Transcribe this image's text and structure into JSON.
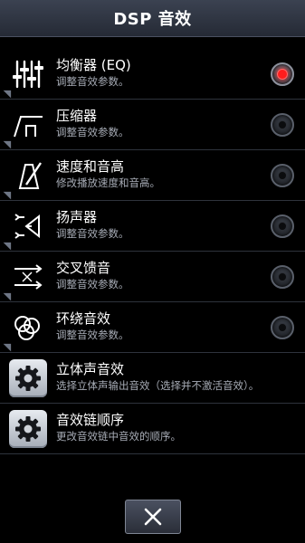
{
  "header": {
    "title": "DSP 音效"
  },
  "items": [
    {
      "name": "均衡器 (EQ)",
      "desc": "调整音效参数。",
      "icon": "equalizer-icon",
      "selected": true
    },
    {
      "name": "压缩器",
      "desc": "调整音效参数。",
      "icon": "compressor-icon",
      "selected": false
    },
    {
      "name": "速度和音高",
      "desc": "修改播放速度和音高。",
      "icon": "metronome-icon",
      "selected": false
    },
    {
      "name": "扬声器",
      "desc": "调整音效参数。",
      "icon": "speaker-icon",
      "selected": false
    },
    {
      "name": "交叉馈音",
      "desc": "调整音效参数。",
      "icon": "crossfeed-icon",
      "selected": false
    },
    {
      "name": "环绕音效",
      "desc": "调整音效参数。",
      "icon": "surround-icon",
      "selected": false
    },
    {
      "name": "立体声音效",
      "desc": "选择立体声输出音效（选择并不激活音效）。",
      "icon": "gear-icon"
    },
    {
      "name": "音效链顺序",
      "desc": "更改音效链中音效的顺序。",
      "icon": "gear-icon"
    }
  ],
  "footer": {
    "close_icon": "close-icon"
  },
  "colors": {
    "accent": "#ff1d1d",
    "header_bg": "#2f3542",
    "text_secondary": "#a7acb6"
  }
}
